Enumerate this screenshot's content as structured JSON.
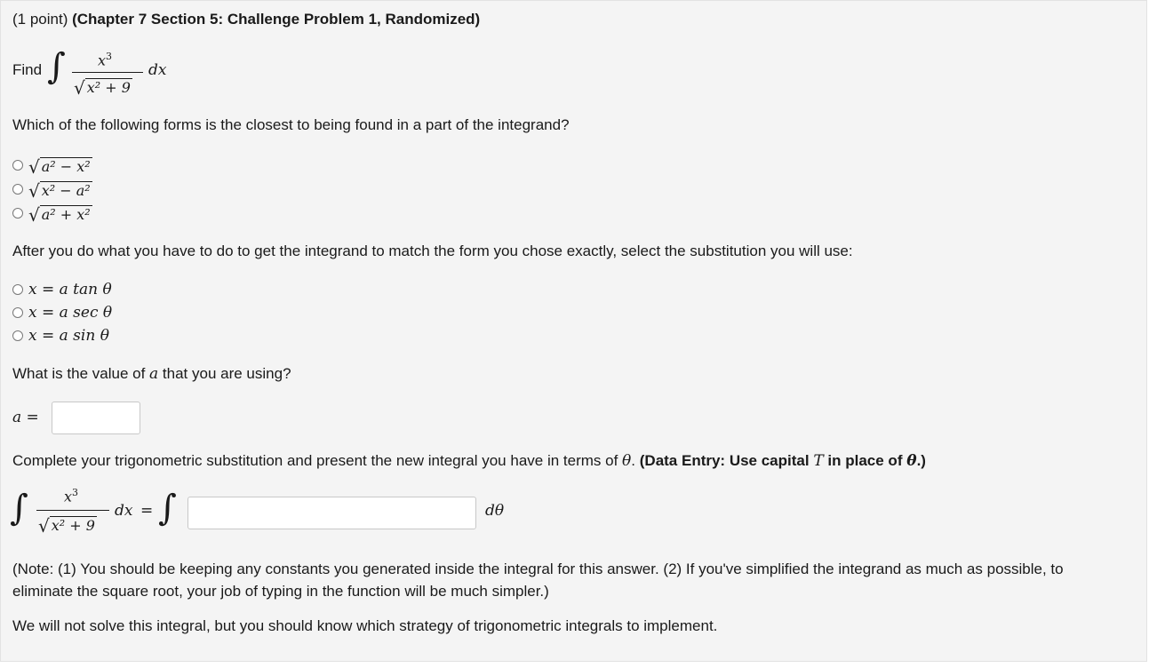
{
  "header": {
    "points": "(1 point)",
    "title": "(Chapter 7 Section 5: Challenge Problem 1, Randomized)"
  },
  "problem": {
    "find_label": "Find",
    "integrand_num": "x",
    "integrand_num_exp": "3",
    "integrand_den": "x² + 9",
    "dx": "dx"
  },
  "q1": {
    "text": "Which of the following forms is the closest to being found in a part of the integrand?",
    "options": [
      "a² − x²",
      "x² − a²",
      "a² + x²"
    ]
  },
  "q2": {
    "text": "After you do what you have to do to get the integrand to match the form you chose exactly, select the substitution you will use:",
    "options": [
      "x = a tan θ",
      "x = a sec θ",
      "x = a sin θ"
    ]
  },
  "q3": {
    "text_before": "What is the value of",
    "var": "a",
    "text_after": "that you are using?",
    "answer_label": "a =",
    "answer_value": ""
  },
  "q4": {
    "text_before": "Complete your trigonometric substitution and present the new integral you have in terms of",
    "theta": "θ",
    "text_mid": ". ",
    "bold_part1": "(Data Entry: Use capital",
    "bold_T": "T",
    "bold_part2": "in place of",
    "bold_theta": "θ",
    "bold_end": ".)",
    "lhs_num": "x",
    "lhs_num_exp": "3",
    "lhs_den": "x² + 9",
    "dx": "dx",
    "equals": "=",
    "dtheta": "dθ",
    "answer_value": ""
  },
  "notes": {
    "note": "(Note: (1) You should be keeping any constants you generated inside the integral for this answer. (2) If you've simplified the integrand as much as possible, to eliminate the square root, your job of typing in the function will be much simpler.)",
    "closing": "We will not solve this integral, but you should know which strategy of trigonometric integrals to implement."
  }
}
